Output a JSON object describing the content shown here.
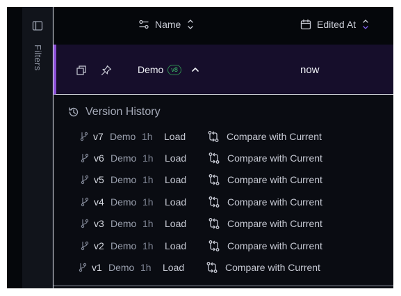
{
  "sidebar": {
    "filters_label": "Filters",
    "toggle_icon": "sidebar-toggle-icon"
  },
  "header": {
    "columns": [
      {
        "label": "Name",
        "icon": "sliders-icon",
        "sort_icon": "sort-updown-icon"
      },
      {
        "label": "Edited At",
        "icon": "calendar-icon",
        "sort_icon": "sort-updown-icon"
      }
    ]
  },
  "row": {
    "name": "Demo",
    "version_badge": "v8",
    "edited_at": "now",
    "accent_color": "#8a4dd8"
  },
  "version_history": {
    "title": "Version History",
    "entries": [
      {
        "version": "v7",
        "name": "Demo",
        "age": "1h",
        "load_label": "Load",
        "compare_label": "Compare with Current"
      },
      {
        "version": "v6",
        "name": "Demo",
        "age": "1h",
        "load_label": "Load",
        "compare_label": "Compare with Current"
      },
      {
        "version": "v5",
        "name": "Demo",
        "age": "1h",
        "load_label": "Load",
        "compare_label": "Compare with Current"
      },
      {
        "version": "v4",
        "name": "Demo",
        "age": "1h",
        "load_label": "Load",
        "compare_label": "Compare with Current"
      },
      {
        "version": "v3",
        "name": "Demo",
        "age": "1h",
        "load_label": "Load",
        "compare_label": "Compare with Current"
      },
      {
        "version": "v2",
        "name": "Demo",
        "age": "1h",
        "load_label": "Load",
        "compare_label": "Compare with Current"
      },
      {
        "version": "v1",
        "name": "Demo",
        "age": "1h",
        "load_label": "Load",
        "compare_label": "Compare with Current"
      }
    ]
  }
}
